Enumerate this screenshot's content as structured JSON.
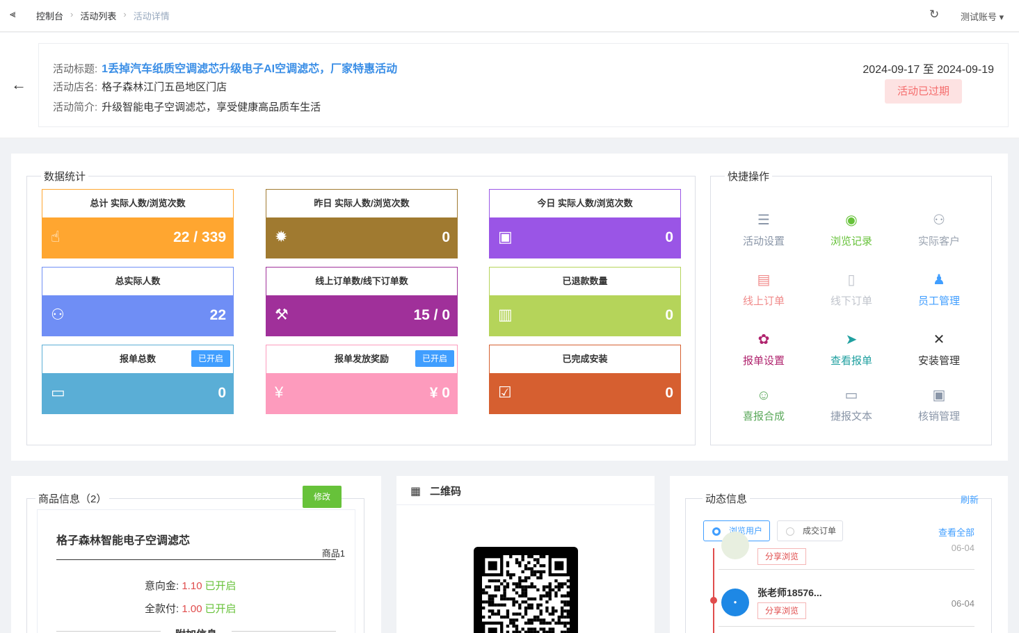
{
  "topbar": {
    "breadcrumbs": [
      "控制台",
      "活动列表",
      "活动详情"
    ],
    "account": "测试账号"
  },
  "activity": {
    "title_label": "活动标题:",
    "title": "1丢掉汽车纸质空调滤芯升级电子AI空调滤芯，厂家特惠活动",
    "store_label": "活动店名:",
    "store": "格子森林江门五邑地区门店",
    "intro_label": "活动简介:",
    "intro": "升级智能电子空调滤芯，享受健康高品质车生活",
    "dates": "2024-09-17 至 2024-09-19",
    "status": "活动已过期"
  },
  "stats": {
    "legend": "数据统计",
    "tiles": [
      {
        "label": "总计 实际人数/浏览次数",
        "value": "22 / 339",
        "color": "#ffa630",
        "icon": "hand-icon"
      },
      {
        "label": "昨日 实际人数/浏览次数",
        "value": "0",
        "color": "#a07a30",
        "icon": "gear-icon"
      },
      {
        "label": "今日 实际人数/浏览次数",
        "value": "0",
        "color": "#9a55e6",
        "icon": "calendar-icon"
      },
      {
        "label": "总实际人数",
        "value": "22",
        "color": "#6f8ef5",
        "icon": "users-icon"
      },
      {
        "label": "线上订单数/线下订单数",
        "value": "15 / 0",
        "color": "#a0309a",
        "icon": "gavel-icon"
      },
      {
        "label": "已退款数量",
        "value": "0",
        "color": "#b5d45a",
        "icon": "refund-icon"
      },
      {
        "label": "报单总数",
        "value": "0",
        "color": "#5aaed6",
        "icon": "wallet-icon",
        "badge": "已开启"
      },
      {
        "label": "报单发放奖励",
        "value": "¥ 0",
        "color": "#fd9bbd",
        "icon": "yen-icon",
        "badge": "已开启"
      },
      {
        "label": "已完成安装",
        "value": "0",
        "color": "#d65f30",
        "icon": "check-doc-icon"
      }
    ]
  },
  "quick": {
    "legend": "快捷操作",
    "items": [
      {
        "label": "活动设置",
        "color": "#8a96a8",
        "icon": "sliders-icon",
        "glyph": "☰"
      },
      {
        "label": "浏览记录",
        "color": "#67c23a",
        "icon": "eye-icon",
        "glyph": "◉"
      },
      {
        "label": "实际客户",
        "color": "#9aa3b0",
        "icon": "customers-icon",
        "glyph": "⚇"
      },
      {
        "label": "线上订单",
        "color": "#f08a8a",
        "icon": "clipboard-icon",
        "glyph": "▤"
      },
      {
        "label": "线下订单",
        "color": "#c0c4cc",
        "icon": "document-icon",
        "glyph": "▯"
      },
      {
        "label": "员工管理",
        "color": "#409eff",
        "icon": "staff-icon",
        "glyph": "♟"
      },
      {
        "label": "报单设置",
        "color": "#b0246e",
        "icon": "cog-icon",
        "glyph": "✿"
      },
      {
        "label": "查看报单",
        "color": "#20a0a0",
        "icon": "send-icon",
        "glyph": "➤"
      },
      {
        "label": "安装管理",
        "color": "#333333",
        "icon": "tools-icon",
        "glyph": "✕"
      },
      {
        "label": "喜报合成",
        "color": "#5aa85a",
        "icon": "smile-icon",
        "glyph": "☺"
      },
      {
        "label": "捷报文本",
        "color": "#8a96a8",
        "icon": "message-icon",
        "glyph": "▭"
      },
      {
        "label": "核销管理",
        "color": "#8a96a8",
        "icon": "verify-icon",
        "glyph": "▣"
      }
    ]
  },
  "goods": {
    "legend": "商品信息（2）",
    "edit": "修改",
    "name": "格子森林智能电子空调滤芯",
    "tag": "商品1",
    "deposit_label": "意向金:",
    "deposit": "1.10",
    "deposit_status": "已开启",
    "full_label": "全款付:",
    "full": "1.00",
    "full_status": "已开启",
    "extra": "附加信息"
  },
  "qr": {
    "title": "二维码"
  },
  "dynamic": {
    "legend": "动态信息",
    "refresh": "刷新",
    "tab_browse": "浏览用户",
    "tab_deal": "成交订单",
    "view_all": "查看全部",
    "feed": [
      {
        "share": "分享浏览",
        "time": "06-04"
      },
      {
        "name": "张老师18576...",
        "share": "分享浏览",
        "time": "06-04"
      }
    ]
  }
}
